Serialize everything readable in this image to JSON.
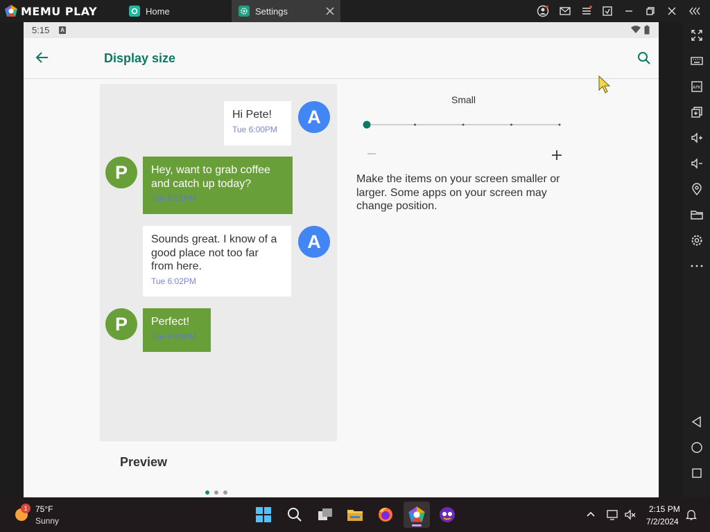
{
  "titlebar": {
    "brand": "MEMU PLAY",
    "tabs": [
      {
        "label": "Home",
        "icon": "home-app-icon"
      },
      {
        "label": "Settings",
        "icon": "settings-gear-icon"
      }
    ]
  },
  "statusbar": {
    "time": "5:15",
    "notif_letter": "A"
  },
  "appbar": {
    "title": "Display size"
  },
  "preview": {
    "label": "Preview",
    "messages": [
      {
        "avatar": "A",
        "text": "Hi Pete!",
        "time": "Tue 6:00PM",
        "side": "out"
      },
      {
        "avatar": "P",
        "text": "Hey, want to grab coffee and catch up today?",
        "time": "Tue 6:01PM",
        "side": "in"
      },
      {
        "avatar": "A",
        "text": "Sounds great. I know of a good place not too far from here.",
        "time": "Tue 6:02PM",
        "side": "out"
      },
      {
        "avatar": "P",
        "text": "Perfect!",
        "time": "Tue 6:03PM",
        "side": "in"
      }
    ]
  },
  "size_control": {
    "label": "Small",
    "steps": 5,
    "selected_index": 0,
    "minus": "−",
    "plus": "+",
    "description": "Make the items on your screen smaller or larger. Some apps on your screen may change position."
  },
  "page_indicator": {
    "count": 3,
    "active": 0
  },
  "taskbar": {
    "weather": {
      "temp": "75°F",
      "condition": "Sunny",
      "badge": "1"
    },
    "clock": {
      "time": "2:15 PM",
      "date": "7/2/2024"
    }
  },
  "colors": {
    "accent": "#0b7a63",
    "bubble_green": "#689f38",
    "avatar_blue": "#4285f4",
    "time_text": "#7a86d8"
  }
}
